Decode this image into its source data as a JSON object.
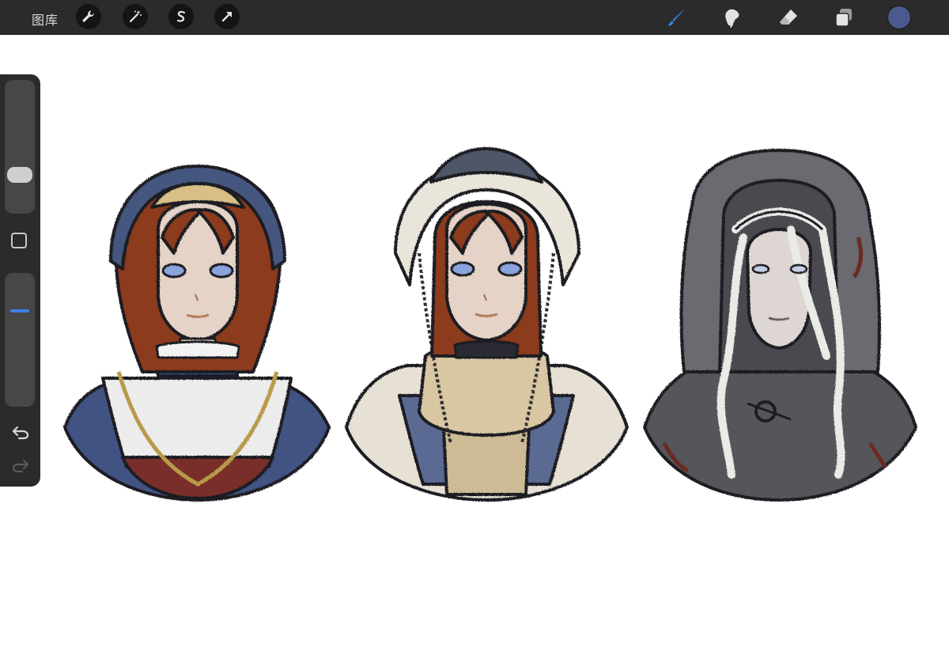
{
  "toolbar": {
    "gallery_label": "图库",
    "left_actions": [
      {
        "icon": "wrench-icon"
      },
      {
        "icon": "magic-wand-icon"
      },
      {
        "icon": "selection-s-icon"
      },
      {
        "icon": "transform-arrow-icon"
      }
    ],
    "right_tools": [
      {
        "icon": "brush-icon",
        "active": true
      },
      {
        "icon": "smudge-icon"
      },
      {
        "icon": "eraser-icon"
      },
      {
        "icon": "layers-icon"
      }
    ],
    "current_color": "#4a5a8e"
  },
  "sidebar": {
    "brush_size_level": 0.25,
    "opacity_level": 0.71,
    "icons": [
      "square-icon",
      "undo-icon",
      "redo-icon"
    ]
  },
  "canvas": {
    "background": "#ffffff",
    "figures": [
      {
        "name": "figure-blue-bonnet",
        "palette": {
          "hood": "#45567f",
          "hair": "#8c3a1f",
          "dress": "#e8e8e8",
          "sleeve": "#3f5283"
        }
      },
      {
        "name": "figure-fur-hood",
        "palette": {
          "hood": "#e7e3d8",
          "hair": "#8c3a1f",
          "dress": "#d9c6a3",
          "sleeve": "#5a6a93"
        }
      },
      {
        "name": "figure-grey-cloak",
        "palette": {
          "hood": "#6b6b6f",
          "hair": "#e9ebe6",
          "dress": "#4a4a4f",
          "sleeve": "#55555a"
        }
      }
    ]
  }
}
